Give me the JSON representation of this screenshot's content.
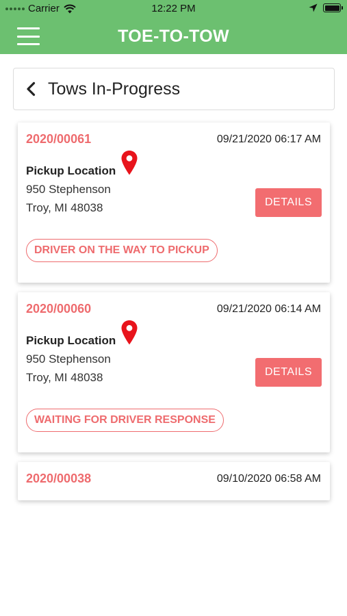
{
  "status_bar": {
    "carrier": "Carrier",
    "time": "12:22 PM",
    "icons": [
      "signal-dots-icon",
      "wifi-icon",
      "location-arrow-icon",
      "battery-icon"
    ]
  },
  "header": {
    "title": "TOE-TO-TOW",
    "background": "#6cc070",
    "menu_icon": "hamburger-menu-icon"
  },
  "page": {
    "title": "Tows In-Progress",
    "back_icon": "chevron-left-icon"
  },
  "colors": {
    "accent": "#ee6b6e",
    "button": "#f26d70",
    "pin": "#e8141c"
  },
  "tows": [
    {
      "id": "2020/00061",
      "datetime": "09/21/2020 06:17 AM",
      "pickup_label": "Pickup Location",
      "address_line1": "950 Stephenson",
      "address_line2": "Troy, MI 48038",
      "details_label": "DETAILS",
      "status": "DRIVER ON THE WAY TO PICKUP",
      "pin_icon": "map-pin-icon"
    },
    {
      "id": "2020/00060",
      "datetime": "09/21/2020 06:14 AM",
      "pickup_label": "Pickup Location",
      "address_line1": "950 Stephenson",
      "address_line2": "Troy, MI 48038",
      "details_label": "DETAILS",
      "status": "WAITING FOR DRIVER RESPONSE",
      "pin_icon": "map-pin-icon"
    },
    {
      "id": "2020/00038",
      "datetime": "09/10/2020 06:58 AM"
    }
  ]
}
